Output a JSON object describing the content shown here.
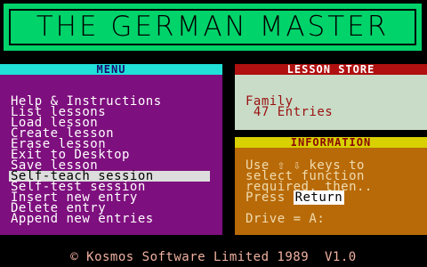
{
  "title": "THE GERMAN MASTER",
  "menu": {
    "header": "MENU",
    "items": [
      "Help & Instructions",
      "List lessons",
      "Load lesson",
      "Create lesson",
      "Erase lesson",
      "Exit to Desktop",
      "Save lesson",
      "Self-teach session",
      "Self-test session",
      "Insert new entry",
      "Delete entry",
      "Append new entries"
    ],
    "selected_index": 7
  },
  "lesson_store": {
    "header": "LESSON STORE",
    "name": "Family",
    "entries": " 47 Entries"
  },
  "information": {
    "header": "INFORMATION",
    "line1": "Use ⇧ ⇩ keys to",
    "line2": "select function",
    "line3": "required, then..",
    "line4_prefix": "Press ",
    "line4_key": "Return",
    "drive": "Drive = A:"
  },
  "footer": "© Kosmos Software Limited 1989  V1.0",
  "colors": {
    "title_bg": "#00d36a",
    "menu_header_bg": "#20e0d8",
    "menu_bg": "#7e0f7e",
    "store_header_bg": "#b01010",
    "store_bg": "#c8dcc8",
    "info_header_bg": "#d8d000",
    "info_bg": "#b86a08"
  }
}
